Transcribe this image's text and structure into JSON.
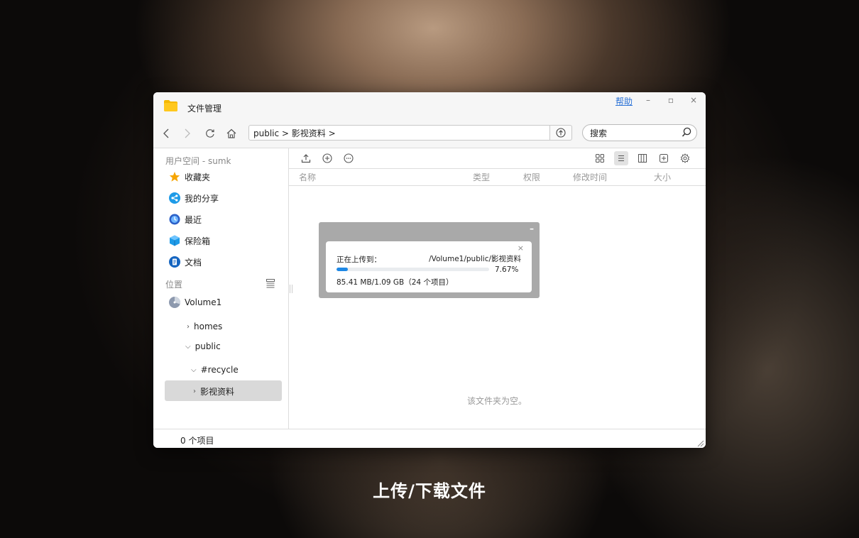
{
  "caption": "上传/下载文件",
  "window": {
    "title": "文件管理",
    "help_label": "帮助",
    "minimize_glyph": "–",
    "maximize_glyph": "▫",
    "close_glyph": "×"
  },
  "pathbar": {
    "segments": [
      "public",
      "影视资料"
    ],
    "separator": ">",
    "text": "public > 影视资料 >"
  },
  "search": {
    "placeholder": "搜索"
  },
  "sidebar": {
    "user_section": "用户空间 - sumk",
    "items": [
      {
        "label": "收藏夹",
        "icon": "star-icon"
      },
      {
        "label": "我的分享",
        "icon": "share-icon"
      },
      {
        "label": "最近",
        "icon": "clock-icon"
      },
      {
        "label": "保险箱",
        "icon": "safe-icon"
      },
      {
        "label": "文档",
        "icon": "document-icon"
      }
    ],
    "location_section": "位置",
    "volume": "Volume1",
    "tree": {
      "homes": "homes",
      "public": "public",
      "recycle": "#recycle",
      "selected": "影视资料"
    }
  },
  "columns": {
    "name": "名称",
    "type": "类型",
    "permission": "权限",
    "modified": "修改时间",
    "size": "大小"
  },
  "empty_text": "该文件夹为空。",
  "status": {
    "count": "0 个项目"
  },
  "upload": {
    "minimize_glyph": "–",
    "close_glyph": "×",
    "label": "正在上传到：",
    "destination": "/Volume1/public/影视资料",
    "percent_text": "7.67%",
    "progress": 0.0767,
    "size_text": "85.41 MB/1.09 GB（24 个项目）"
  },
  "colors": {
    "accent": "#1e88e5",
    "link": "#2b72d6",
    "folder": "#f5b800"
  }
}
